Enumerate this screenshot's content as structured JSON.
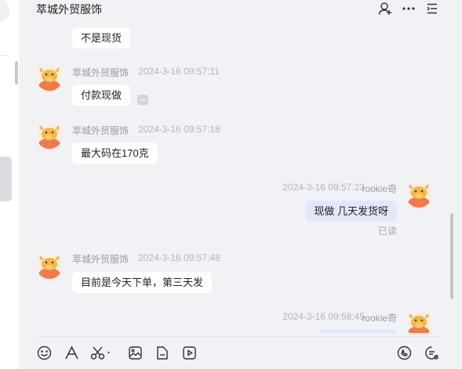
{
  "header": {
    "title": "萃城外贸服饰"
  },
  "messages": [
    {
      "type": "incoming",
      "text": "不是现货"
    },
    {
      "type": "incoming",
      "sender": "萃城外贸服饰",
      "time": "2024-3-16 09:57:11",
      "text": "付款现做"
    },
    {
      "type": "incoming",
      "sender": "萃城外贸服饰",
      "time": "2024-3-16 09:57:18",
      "text": "最大码在170克"
    },
    {
      "type": "outgoing",
      "sender": "rookie奇",
      "time": "2024-3-16 09:57:23",
      "text": "现做  几天发货呀",
      "status": "已读"
    },
    {
      "type": "incoming",
      "sender": "萃城外贸服饰",
      "time": "2024-3-16 09:57:48",
      "text": "目前是今天下单，第三天发"
    },
    {
      "type": "outgoing",
      "sender": "rookie奇",
      "time": "2024-3-16 09:58:45",
      "text": ""
    }
  ],
  "icons": {
    "header": [
      "add-member-icon",
      "more-icon",
      "settings-list-icon"
    ],
    "toolbar": [
      "emoji-icon",
      "text-format-icon",
      "screenshot-icon",
      "image-icon",
      "file-icon",
      "video-icon",
      "call-icon",
      "chat-history-icon"
    ]
  },
  "colors": {
    "panel_bg": "#f1f2f6",
    "mine_bubble": "#e1e8fb",
    "avatar_bg": "#f07a4d"
  }
}
